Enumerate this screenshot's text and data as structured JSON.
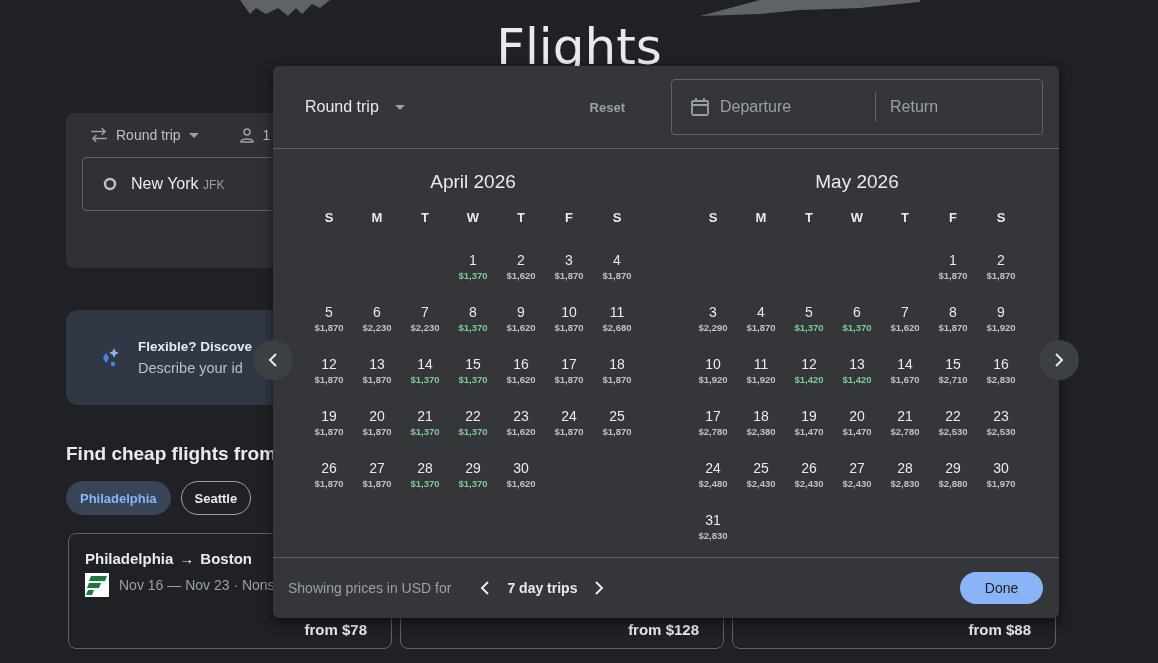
{
  "page_title": "Flights",
  "search": {
    "trip_type": "Round trip",
    "passengers": "1",
    "origin": {
      "city": "New York",
      "code": "JFK"
    }
  },
  "promo": {
    "title": "Flexible? Discove",
    "text": "Describe your id"
  },
  "cheap_flights": {
    "heading": "Find cheap flights from",
    "chips": [
      {
        "label": "Philadelphia",
        "selected": true
      },
      {
        "label": "Seattle",
        "selected": false
      }
    ],
    "cards": [
      {
        "route_from": "Philadelphia",
        "arrow": "→",
        "route_to": "Boston",
        "details": "Nov 16 — Nov 23 · Nons",
        "price": "from $78"
      },
      {
        "price": "from $128"
      },
      {
        "price": "from $88"
      }
    ]
  },
  "date_picker": {
    "trip_type": "Round trip",
    "reset": "Reset",
    "departure_placeholder": "Departure",
    "return_placeholder": "Return",
    "months": [
      {
        "title": "April 2026",
        "weekdays": [
          "S",
          "M",
          "T",
          "W",
          "T",
          "F",
          "S"
        ],
        "weeks": [
          [
            {
              "day": "1",
              "price": "$1,370",
              "cheap": true
            },
            {
              "day": "2",
              "price": "$1,620",
              "cheap": false
            },
            {
              "day": "3",
              "price": "$1,870",
              "cheap": false
            },
            {
              "day": "4",
              "price": "$1,870",
              "cheap": false
            }
          ],
          [
            {
              "day": "5",
              "price": "$1,870",
              "cheap": false
            },
            {
              "day": "6",
              "price": "$2,230",
              "cheap": false
            },
            {
              "day": "7",
              "price": "$2,230",
              "cheap": false
            },
            {
              "day": "8",
              "price": "$1,370",
              "cheap": true
            },
            {
              "day": "9",
              "price": "$1,620",
              "cheap": false
            },
            {
              "day": "10",
              "price": "$1,870",
              "cheap": false
            },
            {
              "day": "11",
              "price": "$2,680",
              "cheap": false
            }
          ],
          [
            {
              "day": "12",
              "price": "$1,870",
              "cheap": false
            },
            {
              "day": "13",
              "price": "$1,870",
              "cheap": false
            },
            {
              "day": "14",
              "price": "$1,370",
              "cheap": true
            },
            {
              "day": "15",
              "price": "$1,370",
              "cheap": true
            },
            {
              "day": "16",
              "price": "$1,620",
              "cheap": false
            },
            {
              "day": "17",
              "price": "$1,870",
              "cheap": false
            },
            {
              "day": "18",
              "price": "$1,870",
              "cheap": false
            }
          ],
          [
            {
              "day": "19",
              "price": "$1,870",
              "cheap": false
            },
            {
              "day": "20",
              "price": "$1,870",
              "cheap": false
            },
            {
              "day": "21",
              "price": "$1,370",
              "cheap": true
            },
            {
              "day": "22",
              "price": "$1,370",
              "cheap": true
            },
            {
              "day": "23",
              "price": "$1,620",
              "cheap": false
            },
            {
              "day": "24",
              "price": "$1,870",
              "cheap": false
            },
            {
              "day": "25",
              "price": "$1,870",
              "cheap": false
            }
          ],
          [
            {
              "day": "26",
              "price": "$1,870",
              "cheap": false
            },
            {
              "day": "27",
              "price": "$1,870",
              "cheap": false
            },
            {
              "day": "28",
              "price": "$1,370",
              "cheap": true
            },
            {
              "day": "29",
              "price": "$1,370",
              "cheap": true
            },
            {
              "day": "30",
              "price": "$1,620",
              "cheap": false
            }
          ]
        ]
      },
      {
        "title": "May 2026",
        "weekdays": [
          "S",
          "M",
          "T",
          "W",
          "T",
          "F",
          "S"
        ],
        "weeks": [
          [
            {
              "day": "1",
              "price": "$1,870",
              "cheap": false
            },
            {
              "day": "2",
              "price": "$1,870",
              "cheap": false
            }
          ],
          [
            {
              "day": "3",
              "price": "$2,290",
              "cheap": false
            },
            {
              "day": "4",
              "price": "$1,870",
              "cheap": false
            },
            {
              "day": "5",
              "price": "$1,370",
              "cheap": true
            },
            {
              "day": "6",
              "price": "$1,370",
              "cheap": true
            },
            {
              "day": "7",
              "price": "$1,620",
              "cheap": false
            },
            {
              "day": "8",
              "price": "$1,870",
              "cheap": false
            },
            {
              "day": "9",
              "price": "$1,920",
              "cheap": false
            }
          ],
          [
            {
              "day": "10",
              "price": "$1,920",
              "cheap": false
            },
            {
              "day": "11",
              "price": "$1,920",
              "cheap": false
            },
            {
              "day": "12",
              "price": "$1,420",
              "cheap": true
            },
            {
              "day": "13",
              "price": "$1,420",
              "cheap": true
            },
            {
              "day": "14",
              "price": "$1,670",
              "cheap": false
            },
            {
              "day": "15",
              "price": "$2,710",
              "cheap": false
            },
            {
              "day": "16",
              "price": "$2,830",
              "cheap": false
            }
          ],
          [
            {
              "day": "17",
              "price": "$2,780",
              "cheap": false
            },
            {
              "day": "18",
              "price": "$2,380",
              "cheap": false
            },
            {
              "day": "19",
              "price": "$1,470",
              "cheap": false
            },
            {
              "day": "20",
              "price": "$1,470",
              "cheap": false
            },
            {
              "day": "21",
              "price": "$2,780",
              "cheap": false
            },
            {
              "day": "22",
              "price": "$2,530",
              "cheap": false
            },
            {
              "day": "23",
              "price": "$2,530",
              "cheap": false
            }
          ],
          [
            {
              "day": "24",
              "price": "$2,480",
              "cheap": false
            },
            {
              "day": "25",
              "price": "$2,430",
              "cheap": false
            },
            {
              "day": "26",
              "price": "$2,430",
              "cheap": false
            },
            {
              "day": "27",
              "price": "$2,430",
              "cheap": false
            },
            {
              "day": "28",
              "price": "$2,830",
              "cheap": false
            },
            {
              "day": "29",
              "price": "$2,880",
              "cheap": false
            },
            {
              "day": "30",
              "price": "$1,970",
              "cheap": false
            }
          ],
          [
            {
              "day": "31",
              "price": "$2,830",
              "cheap": false
            }
          ]
        ]
      }
    ],
    "footer": {
      "note": "Showing prices in USD for",
      "trip_length": "7 day trips",
      "done": "Done"
    }
  }
}
